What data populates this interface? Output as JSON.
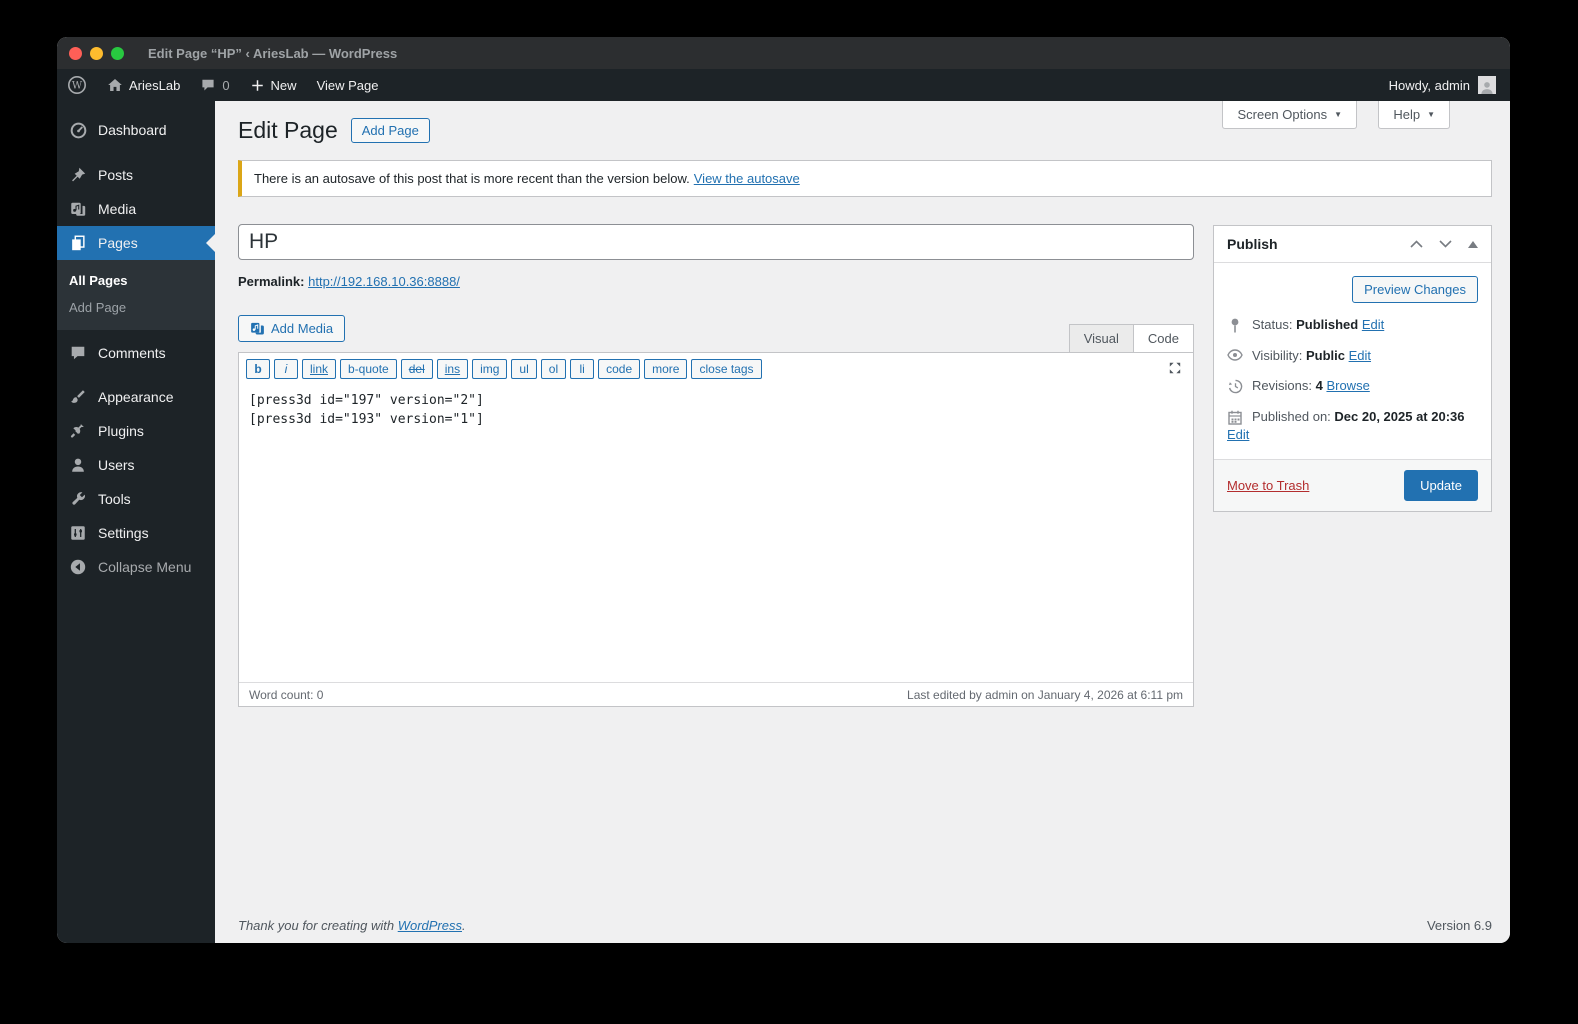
{
  "window": {
    "title": "Edit Page “HP” ‹ AriesLab — WordPress"
  },
  "admin_bar": {
    "site_name": "AriesLab",
    "comments_count": "0",
    "new_label": "New",
    "view_page_label": "View Page",
    "howdy": "Howdy, admin"
  },
  "sidebar": {
    "items": [
      {
        "label": "Dashboard"
      },
      {
        "label": "Posts"
      },
      {
        "label": "Media"
      },
      {
        "label": "Pages"
      },
      {
        "label": "Comments"
      },
      {
        "label": "Appearance"
      },
      {
        "label": "Plugins"
      },
      {
        "label": "Users"
      },
      {
        "label": "Tools"
      },
      {
        "label": "Settings"
      },
      {
        "label": "Collapse Menu"
      }
    ],
    "pages_submenu": [
      "All Pages",
      "Add Page"
    ]
  },
  "header": {
    "title": "Edit Page",
    "add_page_label": "Add Page",
    "screen_options_label": "Screen Options",
    "help_label": "Help"
  },
  "notice": {
    "text": "There is an autosave of this post that is more recent than the version below.",
    "link": "View the autosave"
  },
  "title_field": {
    "value": "HP"
  },
  "permalink": {
    "label": "Permalink:",
    "url": "http://192.168.10.36:8888/"
  },
  "editor": {
    "add_media_label": "Add Media",
    "tabs": {
      "visual": "Visual",
      "code": "Code"
    },
    "quicktags": [
      "b",
      "i",
      "link",
      "b-quote",
      "del",
      "ins",
      "img",
      "ul",
      "ol",
      "li",
      "code",
      "more",
      "close tags"
    ],
    "content_lines": [
      "[press3d id=\"197\" version=\"2\"]",
      "[press3d id=\"193\" version=\"1\"]"
    ],
    "word_count": "Word count: 0",
    "last_edited": "Last edited by admin on January 4, 2026 at 6:11 pm"
  },
  "publish": {
    "title": "Publish",
    "preview_label": "Preview Changes",
    "status": {
      "label": "Status:",
      "value": "Published",
      "edit": "Edit"
    },
    "visibility": {
      "label": "Visibility:",
      "value": "Public",
      "edit": "Edit"
    },
    "revisions": {
      "label": "Revisions:",
      "value": "4",
      "browse": "Browse"
    },
    "published_on": {
      "label": "Published on:",
      "value": "Dec 20, 2025 at 20:36",
      "edit": "Edit"
    },
    "move_to_trash": "Move to Trash",
    "update": "Update"
  },
  "footer": {
    "thanks_prefix": "Thank you for creating with ",
    "wordpress_link": "WordPress",
    "suffix": ".",
    "version": "Version 6.9"
  },
  "colors": {
    "accent": "#2271b1",
    "notice_border": "#dba617",
    "trash": "#b32d2e",
    "sidebar_bg": "#1d2327"
  }
}
